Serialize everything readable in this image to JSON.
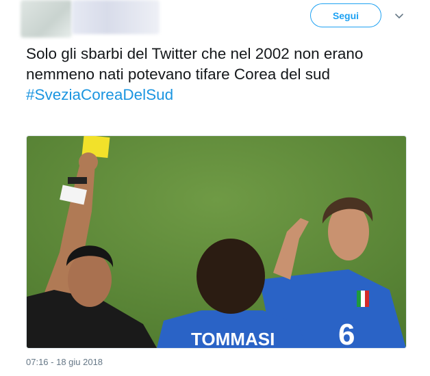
{
  "header": {
    "follow_label": "Segui"
  },
  "tweet": {
    "text": "Solo gli sbarbi del Twitter che nel 2002 non erano nemmeno nati potevano tifare Corea del sud",
    "hashtag": "#SveziaCoreaDelSud",
    "timestamp": "07:16 - 18 giu 2018"
  },
  "media": {
    "shirt_text": "TOMMASI",
    "shirt_number": "6"
  },
  "colors": {
    "accent": "#1da1f2",
    "hashtag": "#1b95e0",
    "pitch": "#5f8a3a",
    "jersey": "#2a63c6",
    "card": "#f2e12a"
  },
  "icons": {
    "caret": "chevron-down-icon"
  }
}
